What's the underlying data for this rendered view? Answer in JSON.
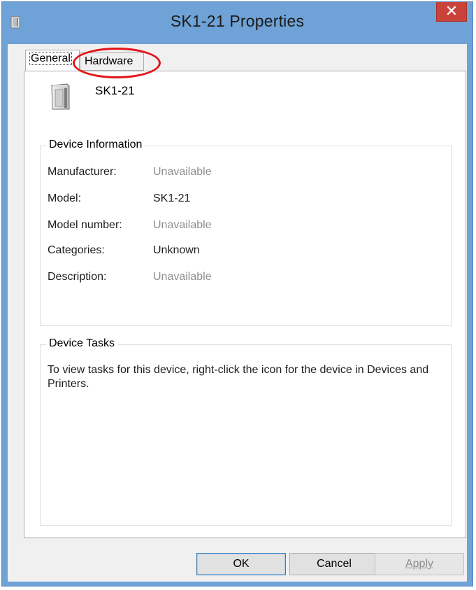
{
  "window": {
    "title": "SK1-21 Properties",
    "close_glyph": "✕",
    "app_icon": "device-icon"
  },
  "tabs": [
    {
      "label": "General",
      "selected": true
    },
    {
      "label": "Hardware",
      "selected": false
    }
  ],
  "device": {
    "name": "SK1-21",
    "icon": "printer-device-icon"
  },
  "device_information": {
    "legend": "Device Information",
    "rows": [
      {
        "label": "Manufacturer:",
        "value": "Unavailable"
      },
      {
        "label": "Model:",
        "value": "SK1-21"
      },
      {
        "label": "Model number:",
        "value": "Unavailable"
      },
      {
        "label": "Categories:",
        "value": "Unknown"
      },
      {
        "label": "Description:",
        "value": "Unavailable"
      }
    ]
  },
  "device_tasks": {
    "legend": "Device Tasks",
    "text": "To view tasks for this device, right-click the icon for the device in Devices and Printers."
  },
  "buttons": {
    "ok": "OK",
    "cancel": "Cancel",
    "apply": "Apply"
  },
  "colors": {
    "titlebar": "#6fa2d6",
    "close_button": "#c9433a",
    "annotation": "#e4151b",
    "disabled_text": "#8d8d8d"
  }
}
